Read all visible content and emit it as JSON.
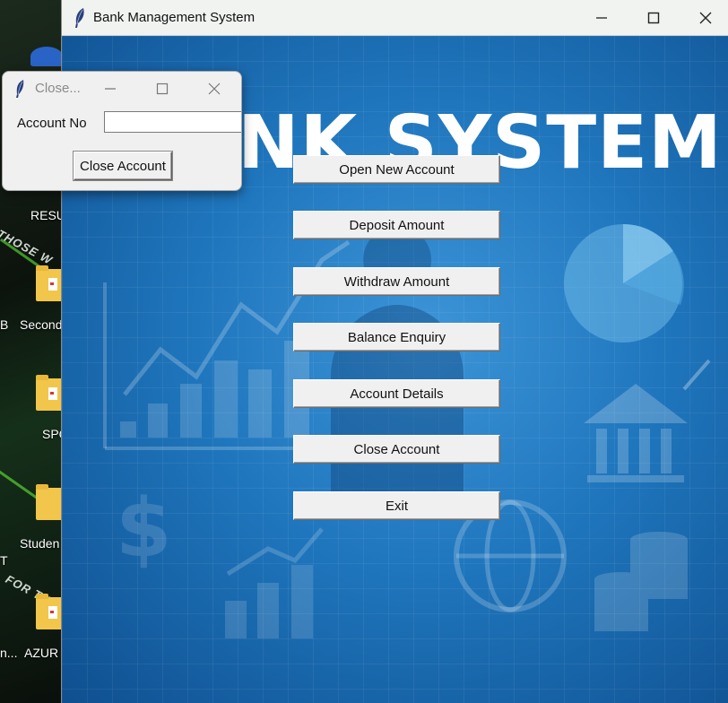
{
  "desktop": {
    "labels": [
      "RESU",
      "Second",
      "B",
      "SPC",
      "Studen",
      "T",
      "AZUR",
      "n..."
    ],
    "slogans": [
      "THOSE W",
      "FOR TH"
    ]
  },
  "main_window": {
    "title": "Bank Management System",
    "heading": "NK SYSTEM",
    "buttons": [
      "Open New Account",
      "Deposit Amount",
      "Withdraw Amount",
      "Balance Enquiry",
      "Account Details",
      "Close Account",
      "Exit"
    ]
  },
  "dialog": {
    "title": "Close...",
    "field_label": "Account No",
    "field_value": "",
    "button_label": "Close Account"
  },
  "icons": {
    "app": "feather-icon",
    "minimize": "minimize-icon",
    "maximize": "maximize-icon",
    "close": "close-icon"
  }
}
